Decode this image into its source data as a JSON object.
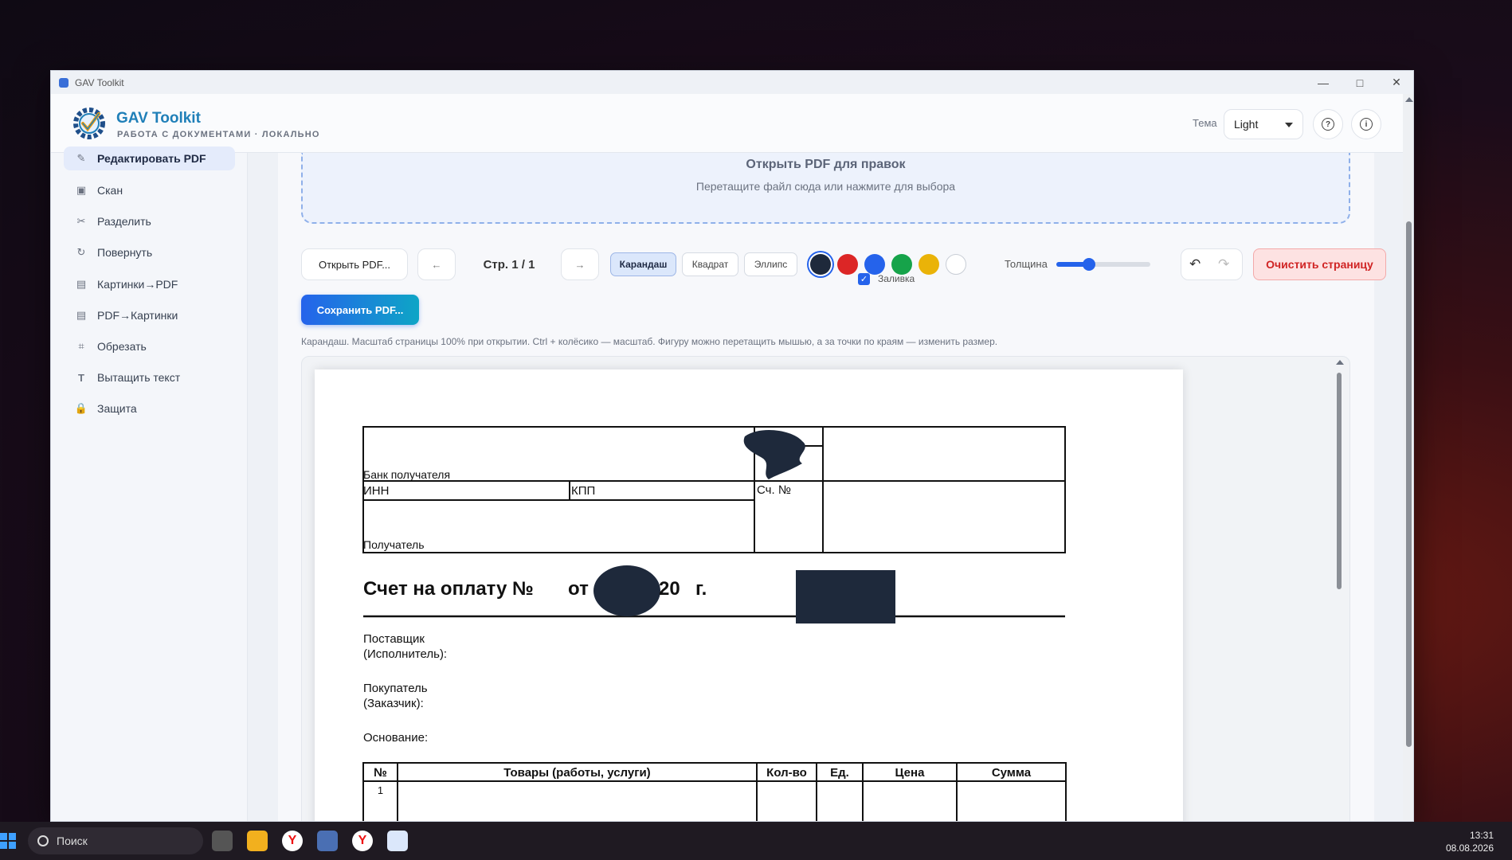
{
  "window": {
    "title": "GAV Toolkit"
  },
  "header": {
    "brand_title": "GAV Toolkit",
    "brand_subtitle": "РАБОТА С ДОКУМЕНТАМИ · ЛОКАЛЬНО",
    "theme_label": "Тема",
    "theme_value": "Light",
    "help_glyph": "?",
    "info_glyph": "i"
  },
  "sidebar": {
    "items": [
      {
        "label": "Редактировать PDF",
        "icon": "edit-icon",
        "active": true
      },
      {
        "label": "Скан",
        "icon": "scan-icon"
      },
      {
        "label": "Разделить",
        "icon": "scissors-icon"
      },
      {
        "label": "Повернуть",
        "icon": "rotate-icon"
      },
      {
        "label": "Картинки→PDF",
        "icon": "image-icon"
      },
      {
        "label": "PDF→Картинки",
        "icon": "image-icon"
      },
      {
        "label": "Обрезать",
        "icon": "crop-icon"
      },
      {
        "label": "Вытащить текст",
        "icon": "text-icon"
      },
      {
        "label": "Защита",
        "icon": "lock-icon"
      }
    ]
  },
  "dropzone": {
    "title": "Открыть PDF для правок",
    "subtitle": "Перетащите файл сюда или нажмите для выбора"
  },
  "toolbar": {
    "open_label": "Открыть PDF...",
    "prev_label": "←",
    "page_indicator": "Стр. 1 / 1",
    "next_label": "→",
    "tools": [
      "Карандаш",
      "Квадрат",
      "Эллипс"
    ],
    "active_tool": "Карандаш",
    "colors": [
      "#1e293b",
      "#dc2626",
      "#2563eb",
      "#16a34a",
      "#eab308",
      "#ffffff"
    ],
    "selected_color": "#1e293b",
    "fill_label": "Заливка",
    "fill_checked": true,
    "thickness_label": "Толщина",
    "thickness_fraction": 0.35,
    "undo_glyph": "↶",
    "redo_glyph": "↷",
    "clear_label": "Очистить страницу",
    "save_label": "Сохранить PDF..."
  },
  "hint": "Карандаш. Масштаб страницы 100% при открытии. Ctrl + колёсико — масштаб. Фигуру можно перетащить мышью, а за точки по краям — изменить размер.",
  "document": {
    "bank_label": "Банк получателя",
    "inn_label": "ИНН",
    "kpp_label": "КПП",
    "account_label": "Сч. №",
    "recipient_label": "Получатель",
    "invoice_title_a": "Счет на оплату №",
    "invoice_title_b": "от",
    "invoice_title_c": "20",
    "invoice_title_d": "г.",
    "supplier_label_1": "Поставщик",
    "supplier_label_2": "(Исполнитель):",
    "buyer_label_1": "Покупатель",
    "buyer_label_2": "(Заказчик):",
    "basis_label": "Основание:",
    "table_headers": [
      "№",
      "Товары (работы, услуги)",
      "Кол-во",
      "Ед.",
      "Цена",
      "Сумма"
    ],
    "first_row_num": "1"
  },
  "taskbar": {
    "search_placeholder": "Поиск",
    "time": "13:31",
    "date": "08.08.2026"
  }
}
